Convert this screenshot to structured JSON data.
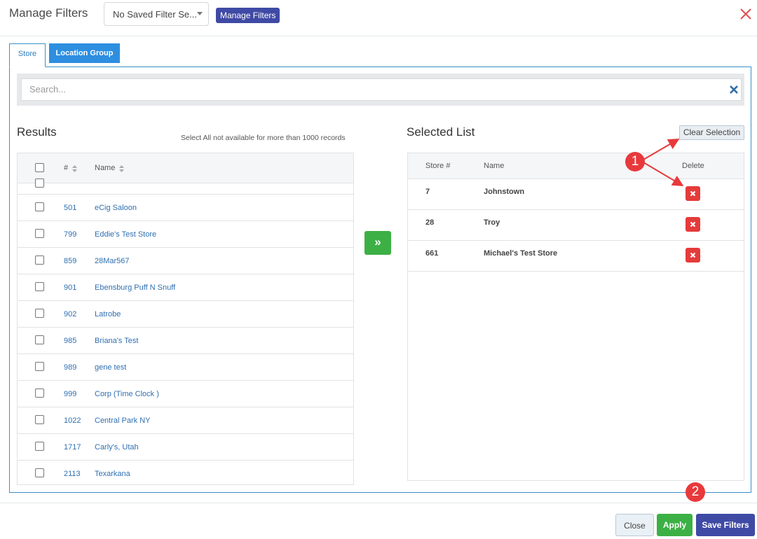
{
  "header": {
    "title": "Manage Filters",
    "saved_filter_value": "No Saved Filter Se...",
    "manage_button": "Manage Filters"
  },
  "tabs": [
    {
      "label": "Store",
      "active": true
    },
    {
      "label": "Location Group",
      "active": false
    }
  ],
  "search": {
    "placeholder": "Search..."
  },
  "results": {
    "title": "Results",
    "note": "Select All not available for more than 1000 records",
    "columns": [
      "#",
      "Name"
    ],
    "rows": [
      {
        "num": "501",
        "name": "eCig Saloon"
      },
      {
        "num": "799",
        "name": "Eddie's Test Store"
      },
      {
        "num": "859",
        "name": "28Mar567"
      },
      {
        "num": "901",
        "name": "Ebensburg Puff N Snuff"
      },
      {
        "num": "902",
        "name": "Latrobe"
      },
      {
        "num": "985",
        "name": "Briana's Test"
      },
      {
        "num": "989",
        "name": "gene test"
      },
      {
        "num": "999",
        "name": "Corp (Time Clock )"
      },
      {
        "num": "1022",
        "name": "Central Park NY"
      },
      {
        "num": "1717",
        "name": "Carly's, Utah"
      },
      {
        "num": "2113",
        "name": "Texarkana"
      }
    ]
  },
  "transfer_icon": "double-chevron-right-icon",
  "selected": {
    "title": "Selected List",
    "clear_button": "Clear Selection",
    "columns": [
      "Store #",
      "Name",
      "Delete"
    ],
    "rows": [
      {
        "num": "7",
        "name": "Johnstown"
      },
      {
        "num": "28",
        "name": "Troy"
      },
      {
        "num": "661",
        "name": "Michael's Test Store"
      }
    ]
  },
  "annotations": [
    "1",
    "2"
  ],
  "footer": {
    "close": "Close",
    "apply": "Apply",
    "save": "Save Filters"
  },
  "colors": {
    "primary": "#3f4aa5",
    "success": "#3cb045",
    "danger": "#e53b3b",
    "link": "#2f6fb1",
    "tab_active_border": "#3a90c8",
    "tab_inactive_bg": "#2e8ee0"
  }
}
